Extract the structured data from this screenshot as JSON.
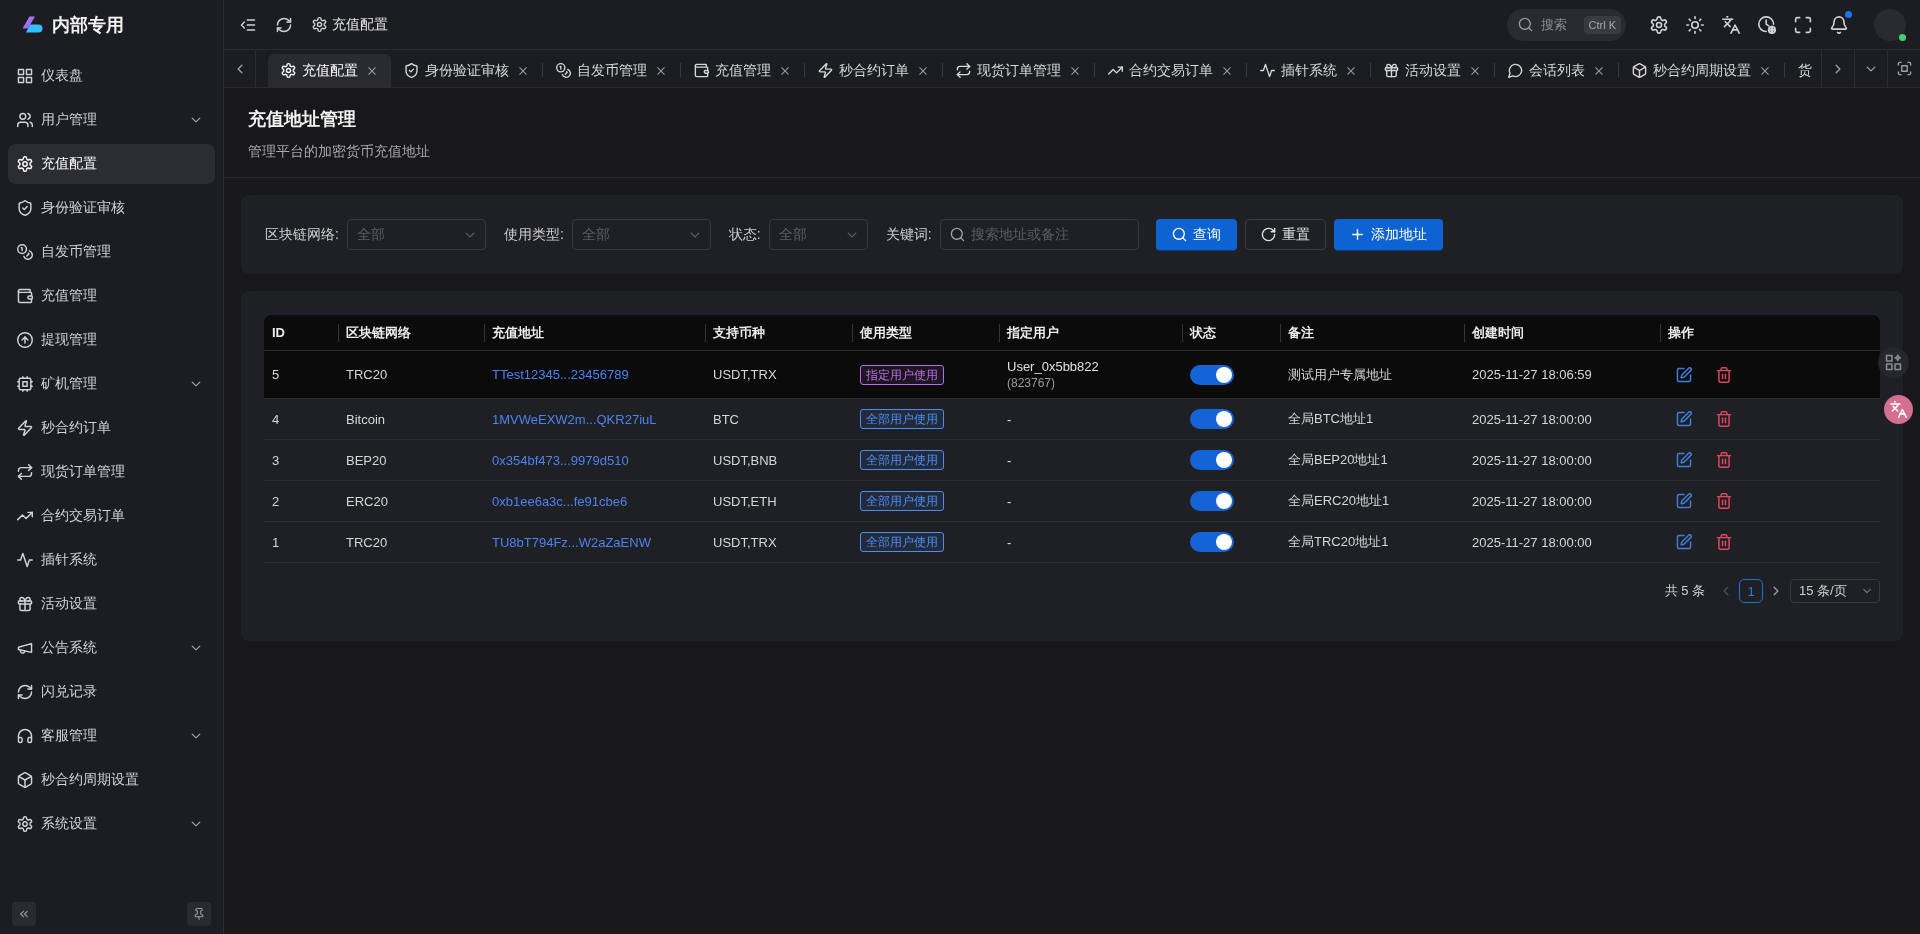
{
  "app": {
    "name": "内部专用"
  },
  "sidebar": {
    "items": [
      {
        "label": "仪表盘",
        "kind": "link",
        "selected": false
      },
      {
        "label": "用户管理",
        "kind": "group",
        "selected": false
      },
      {
        "label": "充值配置",
        "kind": "link",
        "selected": true
      },
      {
        "label": "身份验证审核",
        "kind": "link",
        "selected": false
      },
      {
        "label": "自发币管理",
        "kind": "link",
        "selected": false
      },
      {
        "label": "充值管理",
        "kind": "link",
        "selected": false
      },
      {
        "label": "提现管理",
        "kind": "link",
        "selected": false
      },
      {
        "label": "矿机管理",
        "kind": "group",
        "selected": false
      },
      {
        "label": "秒合约订单",
        "kind": "link",
        "selected": false
      },
      {
        "label": "现货订单管理",
        "kind": "link",
        "selected": false
      },
      {
        "label": "合约交易订单",
        "kind": "link",
        "selected": false
      },
      {
        "label": "插针系统",
        "kind": "link",
        "selected": false
      },
      {
        "label": "活动设置",
        "kind": "link",
        "selected": false
      },
      {
        "label": "公告系统",
        "kind": "group",
        "selected": false
      },
      {
        "label": "闪兑记录",
        "kind": "link",
        "selected": false
      },
      {
        "label": "客服管理",
        "kind": "group",
        "selected": false
      },
      {
        "label": "秒合约周期设置",
        "kind": "link",
        "selected": false
      },
      {
        "label": "系统设置",
        "kind": "group",
        "selected": false
      }
    ]
  },
  "header": {
    "breadcrumb": "充值配置",
    "search": {
      "placeholder": "搜索",
      "shortcut": "Ctrl K"
    },
    "notifications": {
      "unread": true
    },
    "user": {
      "online": true
    }
  },
  "tabs": [
    {
      "label": "充值配置",
      "selected": true,
      "closable": true
    },
    {
      "label": "身份验证审核",
      "selected": false,
      "closable": true
    },
    {
      "label": "自发币管理",
      "selected": false,
      "closable": true
    },
    {
      "label": "充值管理",
      "selected": false,
      "closable": true
    },
    {
      "label": "秒合约订单",
      "selected": false,
      "closable": true
    },
    {
      "label": "现货订单管理",
      "selected": false,
      "closable": true
    },
    {
      "label": "合约交易订单",
      "selected": false,
      "closable": true
    },
    {
      "label": "插针系统",
      "selected": false,
      "closable": true
    },
    {
      "label": "活动设置",
      "selected": false,
      "closable": true
    },
    {
      "label": "会话列表",
      "selected": false,
      "closable": true
    },
    {
      "label": "秒合约周期设置",
      "selected": false,
      "closable": true
    },
    {
      "label": "货",
      "selected": false,
      "closable": false
    }
  ],
  "page": {
    "title": "充值地址管理",
    "subtitle": "管理平台的加密货币充值地址"
  },
  "filters": [
    {
      "label": "区块链网络:",
      "kind": "select",
      "placeholder": "全部"
    },
    {
      "label": "使用类型:",
      "kind": "select",
      "placeholder": "全部"
    },
    {
      "label": "状态:",
      "kind": "select",
      "placeholder": "全部"
    },
    {
      "label": "关键词:",
      "kind": "search",
      "placeholder": "搜索地址或备注"
    }
  ],
  "actions": [
    {
      "label": "查询",
      "kind": "primary"
    },
    {
      "label": "重置",
      "kind": "default"
    },
    {
      "label": "添加地址",
      "kind": "primary"
    }
  ],
  "table": {
    "columns": [
      "ID",
      "区块链网络",
      "充值地址",
      "支持币种",
      "使用类型",
      "指定用户",
      "状态",
      "备注",
      "创建时间",
      "操作"
    ],
    "rows": [
      {
        "id": "5",
        "network": "TRC20",
        "address": "TTest12345...23456789",
        "coins": "USDT,TRX",
        "usage": {
          "label": "指定用户使用",
          "color": "#b86ee0"
        },
        "user": {
          "name": "User_0x5bb822",
          "uid": "(823767)"
        },
        "enabled": true,
        "note": "测试用户专属地址",
        "created": "2025-11-27 18:06:59",
        "highlighted": true
      },
      {
        "id": "4",
        "network": "Bitcoin",
        "address": "1MVWeEXW2m...QKR27iuL",
        "coins": "BTC",
        "usage": {
          "label": "全部用户使用",
          "color": "#4c8df5"
        },
        "user": {
          "name": "-"
        },
        "enabled": true,
        "note": "全局BTC地址1",
        "created": "2025-11-27 18:00:00",
        "highlighted": false
      },
      {
        "id": "3",
        "network": "BEP20",
        "address": "0x354bf473...9979d510",
        "coins": "USDT,BNB",
        "usage": {
          "label": "全部用户使用",
          "color": "#4c8df5"
        },
        "user": {
          "name": "-"
        },
        "enabled": true,
        "note": "全局BEP20地址1",
        "created": "2025-11-27 18:00:00",
        "highlighted": false
      },
      {
        "id": "2",
        "network": "ERC20",
        "address": "0xb1ee6a3c...fe91cbe6",
        "coins": "USDT,ETH",
        "usage": {
          "label": "全部用户使用",
          "color": "#4c8df5"
        },
        "user": {
          "name": "-"
        },
        "enabled": true,
        "note": "全局ERC20地址1",
        "created": "2025-11-27 18:00:00",
        "highlighted": false
      },
      {
        "id": "1",
        "network": "TRC20",
        "address": "TU8bT794Fz...W2aZaENW",
        "coins": "USDT,TRX",
        "usage": {
          "label": "全部用户使用",
          "color": "#4c8df5"
        },
        "user": {
          "name": "-"
        },
        "enabled": true,
        "note": "全局TRC20地址1",
        "created": "2025-11-27 18:00:00",
        "highlighted": false
      }
    ]
  },
  "pagination": {
    "total": "共 5 条",
    "prev_disabled": true,
    "next_disabled": false,
    "pages": [
      {
        "label": "1",
        "selected": true
      }
    ],
    "page_size": "15 条/页"
  }
}
